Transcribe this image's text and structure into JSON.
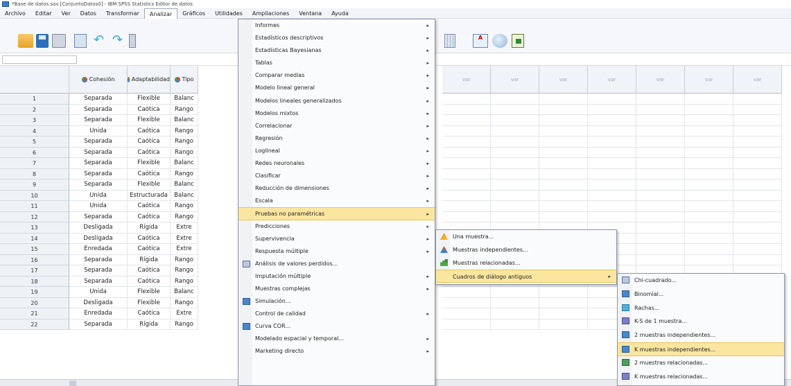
{
  "window": {
    "title": "*Base de datos.sav [ConjuntoDatos0] - IBM SPSS Statistics Editor de datos"
  },
  "menubar": [
    "Archivo",
    "Editar",
    "Ver",
    "Datos",
    "Transformar",
    "Analizar",
    "Gráficos",
    "Utilidades",
    "Ampliaciones",
    "Ventana",
    "Ayuda"
  ],
  "grid": {
    "columns": [
      "Cohesión",
      "Adaptabilidad",
      "Tipo"
    ],
    "empty_columns": [
      "var",
      "var",
      "var",
      "var",
      "var",
      "var",
      "var"
    ],
    "rows": [
      {
        "n": "1",
        "cohesion": "Separada",
        "adaptabilidad": "Flexible",
        "tipo": "Balanc"
      },
      {
        "n": "2",
        "cohesion": "Separada",
        "adaptabilidad": "Caótica",
        "tipo": "Rango"
      },
      {
        "n": "3",
        "cohesion": "Separada",
        "adaptabilidad": "Flexible",
        "tipo": "Balanc"
      },
      {
        "n": "4",
        "cohesion": "Unida",
        "adaptabilidad": "Caótica",
        "tipo": "Rango"
      },
      {
        "n": "5",
        "cohesion": "Separada",
        "adaptabilidad": "Caótica",
        "tipo": "Rango"
      },
      {
        "n": "6",
        "cohesion": "Separada",
        "adaptabilidad": "Caótica",
        "tipo": "Rango"
      },
      {
        "n": "7",
        "cohesion": "Separada",
        "adaptabilidad": "Flexible",
        "tipo": "Balanc"
      },
      {
        "n": "8",
        "cohesion": "Separada",
        "adaptabilidad": "Caótica",
        "tipo": "Rango"
      },
      {
        "n": "9",
        "cohesion": "Separada",
        "adaptabilidad": "Flexible",
        "tipo": "Balanc"
      },
      {
        "n": "10",
        "cohesion": "Unida",
        "adaptabilidad": "Estructurada",
        "tipo": "Balanc"
      },
      {
        "n": "11",
        "cohesion": "Unida",
        "adaptabilidad": "Caótica",
        "tipo": "Rango"
      },
      {
        "n": "12",
        "cohesion": "Separada",
        "adaptabilidad": "Caótica",
        "tipo": "Rango"
      },
      {
        "n": "13",
        "cohesion": "Desligada",
        "adaptabilidad": "Rígida",
        "tipo": "Extre"
      },
      {
        "n": "14",
        "cohesion": "Desligada",
        "adaptabilidad": "Caótica",
        "tipo": "Extre"
      },
      {
        "n": "15",
        "cohesion": "Enredada",
        "adaptabilidad": "Caótica",
        "tipo": "Extre"
      },
      {
        "n": "16",
        "cohesion": "Separada",
        "adaptabilidad": "Rígida",
        "tipo": "Rango"
      },
      {
        "n": "17",
        "cohesion": "Separada",
        "adaptabilidad": "Caótica",
        "tipo": "Rango"
      },
      {
        "n": "18",
        "cohesion": "Separada",
        "adaptabilidad": "Caótica",
        "tipo": "Rango"
      },
      {
        "n": "19",
        "cohesion": "Unida",
        "adaptabilidad": "Flexible",
        "tipo": "Balanc"
      },
      {
        "n": "20",
        "cohesion": "Desligada",
        "adaptabilidad": "Flexible",
        "tipo": "Rango"
      },
      {
        "n": "21",
        "cohesion": "Enredada",
        "adaptabilidad": "Caótica",
        "tipo": "Extre"
      },
      {
        "n": "22",
        "cohesion": "Separada",
        "adaptabilidad": "Rígida",
        "tipo": "Rango"
      }
    ]
  },
  "analizar_menu": [
    {
      "label": "Informes",
      "submenu": true
    },
    {
      "label": "Estadísticos descriptivos",
      "submenu": true
    },
    {
      "label": "Estadísticas Bayesianas",
      "submenu": true
    },
    {
      "label": "Tablas",
      "submenu": true
    },
    {
      "label": "Comparar medias",
      "submenu": true
    },
    {
      "label": "Modelo lineal general",
      "submenu": true
    },
    {
      "label": "Modelos lineales generalizados",
      "submenu": true
    },
    {
      "label": "Modelos mixtos",
      "submenu": true
    },
    {
      "label": "Correlacionar",
      "submenu": true
    },
    {
      "label": "Regresión",
      "submenu": true
    },
    {
      "label": "Loglineal",
      "submenu": true
    },
    {
      "label": "Redes neuronales",
      "submenu": true
    },
    {
      "label": "Clasificar",
      "submenu": true
    },
    {
      "label": "Reducción de dimensiones",
      "submenu": true
    },
    {
      "label": "Escala",
      "submenu": true
    },
    {
      "label": "Pruebas no paramétricas",
      "submenu": true,
      "highlighted": true
    },
    {
      "label": "Predicciones",
      "submenu": true
    },
    {
      "label": "Supervivencia",
      "submenu": true
    },
    {
      "label": "Respuesta múltiple",
      "submenu": true
    },
    {
      "label": "Análisis de valores perdidos...",
      "submenu": false,
      "icon": "missing-values-icon"
    },
    {
      "label": "Imputación múltiple",
      "submenu": true
    },
    {
      "label": "Muestras complejas",
      "submenu": true
    },
    {
      "label": "Simulación...",
      "submenu": false,
      "icon": "simulation-icon"
    },
    {
      "label": "Control de calidad",
      "submenu": true
    },
    {
      "label": "Curva COR...",
      "submenu": false,
      "icon": "roc-curve-icon"
    },
    {
      "label": "Modelado espacial y temporal...",
      "submenu": true
    },
    {
      "label": "Marketing directo",
      "submenu": true
    }
  ],
  "nonparam_menu": [
    {
      "label": "Una muestra...",
      "icon": "one-sample-icon"
    },
    {
      "label": "Muestras independientes...",
      "icon": "independent-samples-icon"
    },
    {
      "label": "Muestras relacionadas...",
      "icon": "related-samples-icon"
    },
    {
      "label": "Cuadros de diálogo antiguos",
      "submenu": true,
      "highlighted": true
    }
  ],
  "legacy_menu": [
    {
      "label": "Chi-cuadrado...",
      "icon": "chi-square-icon"
    },
    {
      "label": "Binomial...",
      "icon": "binomial-icon"
    },
    {
      "label": "Rachas...",
      "icon": "runs-icon"
    },
    {
      "label": "K-S de 1 muestra...",
      "icon": "ks-icon"
    },
    {
      "label": "2 muestras independientes...",
      "icon": "two-independent-icon"
    },
    {
      "label": "K muestras independientes...",
      "icon": "k-independent-icon",
      "highlighted": true
    },
    {
      "label": "2 muestras relacionadas...",
      "icon": "two-related-icon"
    },
    {
      "label": "K muestras relacionadas...",
      "icon": "k-related-icon"
    }
  ]
}
